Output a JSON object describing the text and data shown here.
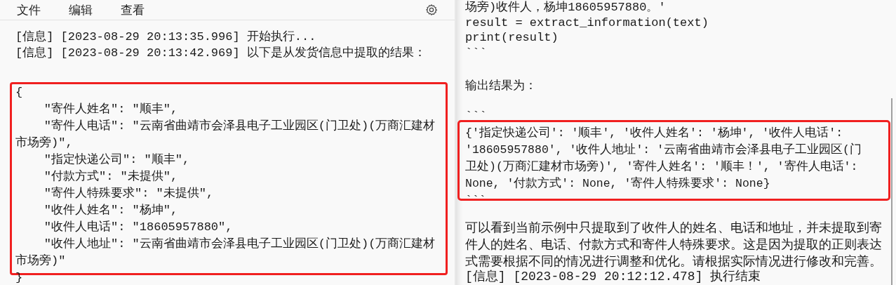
{
  "menu": [
    {
      "label": "文件"
    },
    {
      "label": "编辑"
    },
    {
      "label": "查看"
    }
  ],
  "log": {
    "lines": [
      "[信息] [2023-08-29 20:13:35.996] 开始执行...",
      "[信息] [2023-08-29 20:13:42.969] 以下是从发货信息中提取的结果："
    ],
    "result_lines": [
      "{",
      "    \"寄件人姓名\": \"顺丰\",",
      "    \"寄件人电话\": \"云南省曲靖市会泽县电子工业园区(门卫处)(万商汇建材",
      "市场旁)\",",
      "    \"指定快递公司\": \"顺丰\",",
      "    \"付款方式\": \"未提供\",",
      "    \"寄件人特殊要求\": \"未提供\",",
      "    \"收件人姓名\": \"杨坤\",",
      "    \"收件人电话\": \"18605957880\",",
      "    \"收件人地址\": \"云南省曲靖市会泽县电子工业园区(门卫处)(万商汇建材",
      "市场旁)\"",
      "}"
    ]
  },
  "answer": {
    "code_lines": [
      "场旁)收件人，杨坤18605957880。'",
      "result = extract_information(text)",
      "print(result)",
      "```"
    ],
    "label": "输出结果为：",
    "fence": "```",
    "output_lines": [
      "{'指定快递公司': '顺丰', '收件人姓名': '杨坤', '收件人电话':",
      "'18605957880', '收件人地址': '云南省曲靖市会泽县电子工业园区(门",
      "卫处)(万商汇建材市场旁)', '寄件人姓名': '顺丰！', '寄件人电话':",
      "None, '付款方式': None, '寄件人特殊要求': None}",
      "```"
    ],
    "paragraph": "可以看到当前示例中只提取到了收件人的姓名、电话和地址，并未提取到寄件人的姓名、电话、付款方式和寄件人特殊要求。这是因为提取的正则表达式需要根据不同的情况进行调整和优化。请根据实际情况进行修改和完善。",
    "log_line": "[信息] [2023-08-29 20:12:12.478] 执行结束"
  }
}
